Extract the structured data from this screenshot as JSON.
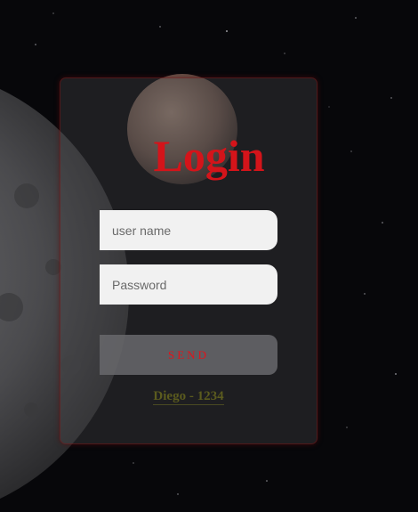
{
  "login": {
    "title": "Login",
    "username_placeholder": "user name",
    "password_placeholder": "Password",
    "send_label": "SEND",
    "hint": "Diego - 1234"
  },
  "colors": {
    "title": "#d4141a",
    "send_text": "#e0141c",
    "hint_text": "#5b5b1e",
    "field_bg": "#f1f1f1",
    "background": "#07070a"
  }
}
